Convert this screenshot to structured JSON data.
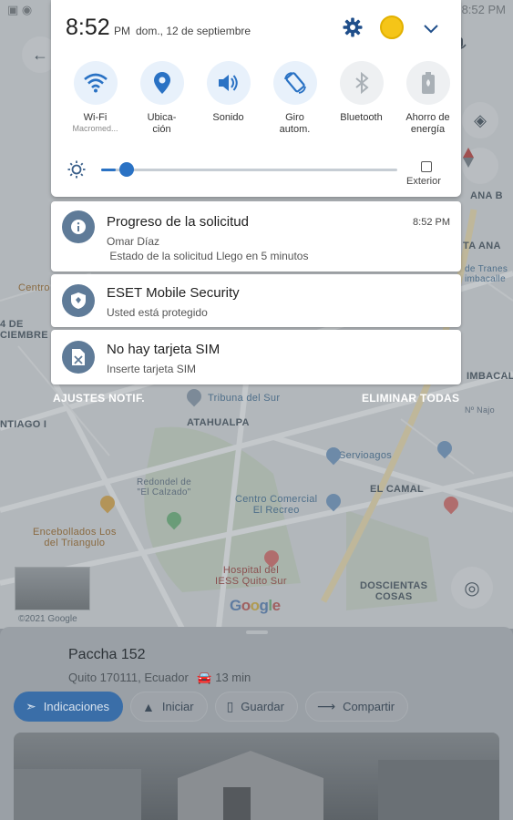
{
  "background_status": {
    "time": "8:52 PM"
  },
  "shade": {
    "time": "8:52",
    "ampm": "PM",
    "date": "dom., 12 de septiembre",
    "tiles": [
      {
        "label": "Wi-Fi",
        "sub": "Macromed...",
        "icon": "wifi-icon",
        "active": true
      },
      {
        "label": "Ubica-\nción",
        "sub": "",
        "icon": "location-icon",
        "active": true
      },
      {
        "label": "Sonido",
        "sub": "",
        "icon": "volume-icon",
        "active": true
      },
      {
        "label": "Giro\nautom.",
        "sub": "",
        "icon": "auto-rotate-icon",
        "active": true
      },
      {
        "label": "Bluetooth",
        "sub": "",
        "icon": "bluetooth-icon",
        "active": false
      },
      {
        "label": "Ahorro de\nenergía",
        "sub": "",
        "icon": "battery-saver-icon",
        "active": false
      }
    ],
    "brightness": 0.05,
    "exterior_label": "Exterior",
    "colors": {
      "accent": "#2a72c4",
      "tile_on": "#e8f1fb"
    }
  },
  "notifications": [
    {
      "icon": "info-icon",
      "title": "Progreso de la solicitud",
      "time": "8:52 PM",
      "line1": "Omar Díaz",
      "line2": " Estado de la solicitud Llego en 5 minutos"
    },
    {
      "icon": "shield-icon",
      "title": "ESET Mobile Security",
      "line1": "Usted está protegido"
    },
    {
      "icon": "sim-icon",
      "title": "No hay tarjeta SIM",
      "line1": "Inserte tarjeta SIM"
    }
  ],
  "footer": {
    "settings": "AJUSTES NOTIF.",
    "clear_all": "ELIMINAR TODAS"
  },
  "map": {
    "labels": {
      "tribuna": "Tribuna del Sur",
      "atahualpa": "ATAHUALPA",
      "servioagos": "Servioagos",
      "el_camal": "EL CAMAL",
      "redondel": "Redondel de\n\"El Calzado\"",
      "centro_comercial": "Centro Comercial\nEl Recreo",
      "encebollados": "Encebollados Los\ndel Triangulo",
      "hospital": "Hospital del\nIESS Quito Sur",
      "doscientas": "DOSCIENTAS\nCOSAS",
      "diciembre": "4 DE\nCIEMBRE",
      "santiago": "NTIAGO I",
      "chimbacalle": "IMBACAL",
      "tarana": "TA ANA",
      "ana_b": "ANA B",
      "nnajo": "Nº Najo",
      "terminal": "de Tranes\nimbacalle",
      "centro": "Centro",
      "copyright": "©2021 Google",
      "google": "Google"
    }
  },
  "place": {
    "title": "Paccha 152",
    "address": "Quito 170111, Ecuador",
    "eta": "13 min",
    "actions": [
      {
        "label": "Indicaciones",
        "icon": "directions-icon"
      },
      {
        "label": "Iniciar",
        "icon": "navigation-arrow-icon"
      },
      {
        "label": "Guardar",
        "icon": "bookmark-icon"
      },
      {
        "label": "Compartir",
        "icon": "share-icon"
      }
    ]
  }
}
